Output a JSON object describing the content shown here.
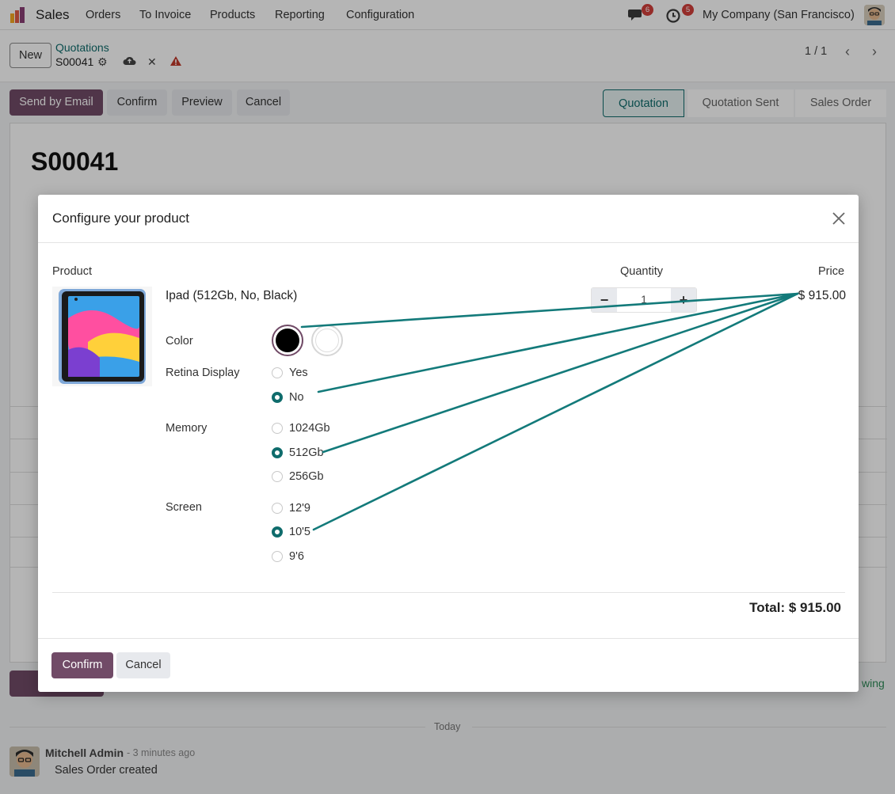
{
  "navbar": {
    "app_name": "Sales",
    "menu": [
      "Orders",
      "To Invoice",
      "Products",
      "Reporting",
      "Configuration"
    ],
    "messages_badge": "6",
    "activities_badge": "5",
    "company": "My Company (San Francisco)"
  },
  "control_panel": {
    "new_label": "New",
    "breadcrumb_parent": "Quotations",
    "breadcrumb_current": "S00041",
    "pager": "1 / 1"
  },
  "actions": {
    "send_by_email": "Send by Email",
    "confirm": "Confirm",
    "preview": "Preview",
    "cancel": "Cancel"
  },
  "stages": [
    "Quotation",
    "Quotation Sent",
    "Sales Order"
  ],
  "form": {
    "title": "S00041"
  },
  "chatter": {
    "separator": "Today",
    "author": "Mitchell Admin",
    "time": "- 3 minutes ago",
    "message": "Sales Order created",
    "following_fragment": "wing"
  },
  "modal": {
    "title": "Configure your product",
    "col_product": "Product",
    "col_quantity": "Quantity",
    "col_price": "Price",
    "product_name": "Ipad (512Gb, No, Black)",
    "quantity": "1",
    "price": "$ 915.00",
    "attributes": {
      "color": {
        "label": "Color",
        "options": [
          "Black",
          "White"
        ],
        "selected": "Black",
        "colors": [
          "#000000",
          "#ffffff"
        ]
      },
      "retina": {
        "label": "Retina Display",
        "options": [
          "Yes",
          "No"
        ],
        "selected": "No"
      },
      "memory": {
        "label": "Memory",
        "options": [
          "1024Gb",
          "512Gb",
          "256Gb"
        ],
        "selected": "512Gb"
      },
      "screen": {
        "label": "Screen",
        "options": [
          "12'9",
          "10'5",
          "9'6"
        ],
        "selected": "10'5"
      }
    },
    "total": "Total: $ 915.00",
    "confirm_label": "Confirm",
    "cancel_label": "Cancel"
  },
  "colors": {
    "primary": "#714b67",
    "teal": "#0f6c6c",
    "annotation_arrow": "#137a7a",
    "badge_red": "#d23f3a"
  }
}
